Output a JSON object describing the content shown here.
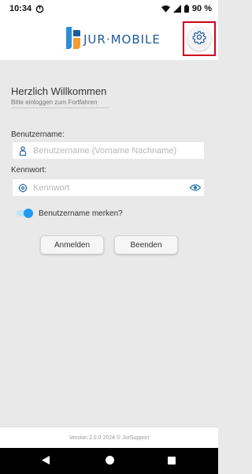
{
  "status_bar": {
    "time": "10:34",
    "battery": "90 %"
  },
  "header": {
    "logo_text": "JUR·MOBILE",
    "settings_icon": "gear-icon"
  },
  "login": {
    "title": "Herzlich Willkommen",
    "subtitle": "Bitte einloggen zum Fortfahren",
    "username_label": "Benutzername:",
    "username_placeholder": "Benutzername (Vorname Nachname)",
    "password_label": "Kennwort:",
    "password_placeholder": "Kennwort",
    "remember_label": "Benutzername merken?",
    "remember_on": true,
    "login_button": "Anmelden",
    "exit_button": "Beenden"
  },
  "footer": {
    "text": "Version 2.0.0 2024 © JurSupport"
  },
  "colors": {
    "accent": "#1e9bf0",
    "logo_blue": "#1d5b9b",
    "logo_orange": "#f39c33",
    "highlight": "#d0021b"
  }
}
